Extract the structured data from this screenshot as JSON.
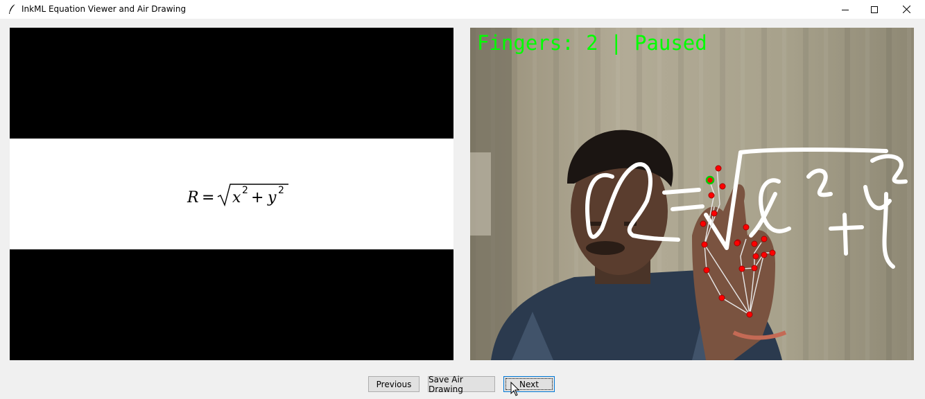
{
  "window": {
    "title": "InkML Equation Viewer and Air Drawing",
    "icon": "feather-icon",
    "controls": [
      "minimize-icon",
      "maximize-icon",
      "close-icon"
    ]
  },
  "equation_viewer": {
    "latex": "R = \\sqrt{x^2 + y^2}",
    "parts": {
      "lhs": "R",
      "equals": "=",
      "x": "x",
      "x_exp": "2",
      "plus": "+",
      "y": "y",
      "y_exp": "2"
    }
  },
  "air_drawing": {
    "status_text": "Fingers: 2 | Paused",
    "status_color": "#00ff00",
    "stroke_color": "#ffffff",
    "landmark_color": "#ff0000",
    "active_fingertip_color": "#00cc00"
  },
  "buttons": {
    "previous": "Previous",
    "save": "Save Air Drawing",
    "next": "Next"
  }
}
